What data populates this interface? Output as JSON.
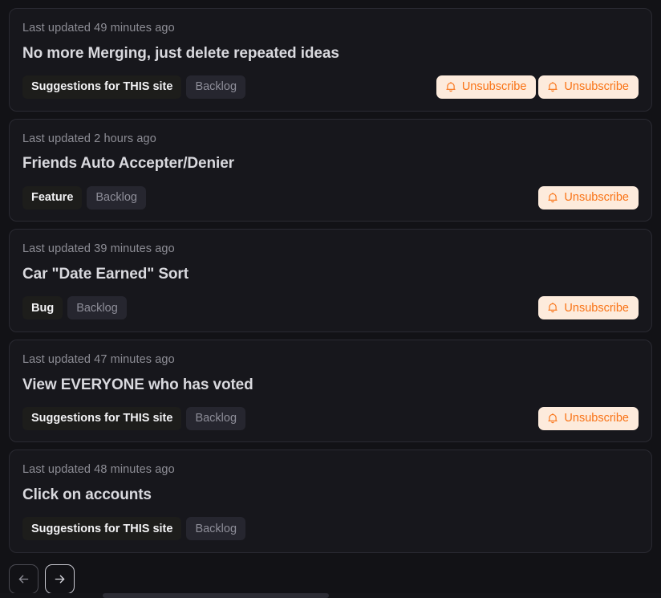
{
  "theme": {
    "page_background": "#121216",
    "card_background": "#17171c",
    "card_border": "#2a2a32",
    "title_color": "#d9d9de",
    "muted_text": "#8d8d95",
    "accent_orange": "#f97316",
    "button_background": "#fdebdc",
    "tag_category_background": "#1d1d1b",
    "tag_status_background": "#26262f"
  },
  "cards": [
    {
      "timestamp": "Last updated 49 minutes ago",
      "title": "No more Merging, just delete repeated ideas",
      "category_tag": "Suggestions for THIS site",
      "status_tag": "Backlog",
      "buttons": [
        {
          "label": "Unsubscribe",
          "icon": "bell-icon"
        },
        {
          "label": "Unsubscribe",
          "icon": "bell-icon"
        }
      ]
    },
    {
      "timestamp": "Last updated 2 hours ago",
      "title": "Friends Auto Accepter/Denier",
      "category_tag": "Feature",
      "status_tag": "Backlog",
      "buttons": [
        {
          "label": "Unsubscribe",
          "icon": "bell-icon"
        }
      ]
    },
    {
      "timestamp": "Last updated 39 minutes ago",
      "title": "Car \"Date Earned\" Sort",
      "category_tag": "Bug",
      "status_tag": "Backlog",
      "buttons": [
        {
          "label": "Unsubscribe",
          "icon": "bell-icon"
        }
      ]
    },
    {
      "timestamp": "Last updated 47 minutes ago",
      "title": "View EVERYONE who has voted",
      "category_tag": "Suggestions for THIS site",
      "status_tag": "Backlog",
      "buttons": [
        {
          "label": "Unsubscribe",
          "icon": "bell-icon"
        }
      ]
    },
    {
      "timestamp": "Last updated 48 minutes ago",
      "title": "Click on accounts",
      "category_tag": "Suggestions for THIS site",
      "status_tag": "Backlog",
      "buttons": []
    }
  ],
  "pagination": {
    "previous": {
      "icon": "arrow-left-icon",
      "label": ""
    },
    "next": {
      "icon": "arrow-right-icon",
      "label": ""
    }
  }
}
